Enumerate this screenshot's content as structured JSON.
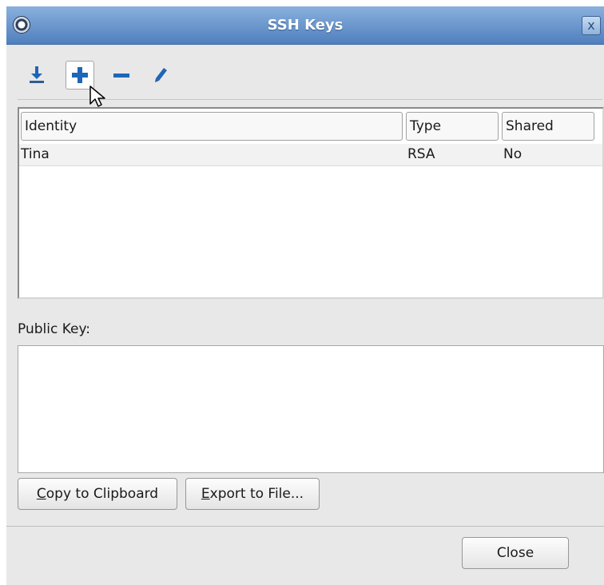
{
  "window": {
    "title": "SSH Keys",
    "close_glyph": "x"
  },
  "toolbar": {
    "buttons": [
      {
        "name": "import-icon"
      },
      {
        "name": "add-icon"
      },
      {
        "name": "remove-icon"
      },
      {
        "name": "edit-icon"
      }
    ]
  },
  "table": {
    "columns": [
      "Identity",
      "Type",
      "Shared"
    ],
    "rows": [
      {
        "identity": "Tina",
        "type": "RSA",
        "shared": "No"
      }
    ]
  },
  "public_key": {
    "label": "Public Key:",
    "value": ""
  },
  "buttons": {
    "copy": {
      "mnemonic": "C",
      "rest": "opy to Clipboard"
    },
    "export": {
      "mnemonic": "E",
      "rest": "xport to File..."
    },
    "close": "Close"
  },
  "colors": {
    "titlebar": "#5b8ac6",
    "icon_blue": "#1e66b8",
    "icon_dark": "#2f5c91"
  }
}
